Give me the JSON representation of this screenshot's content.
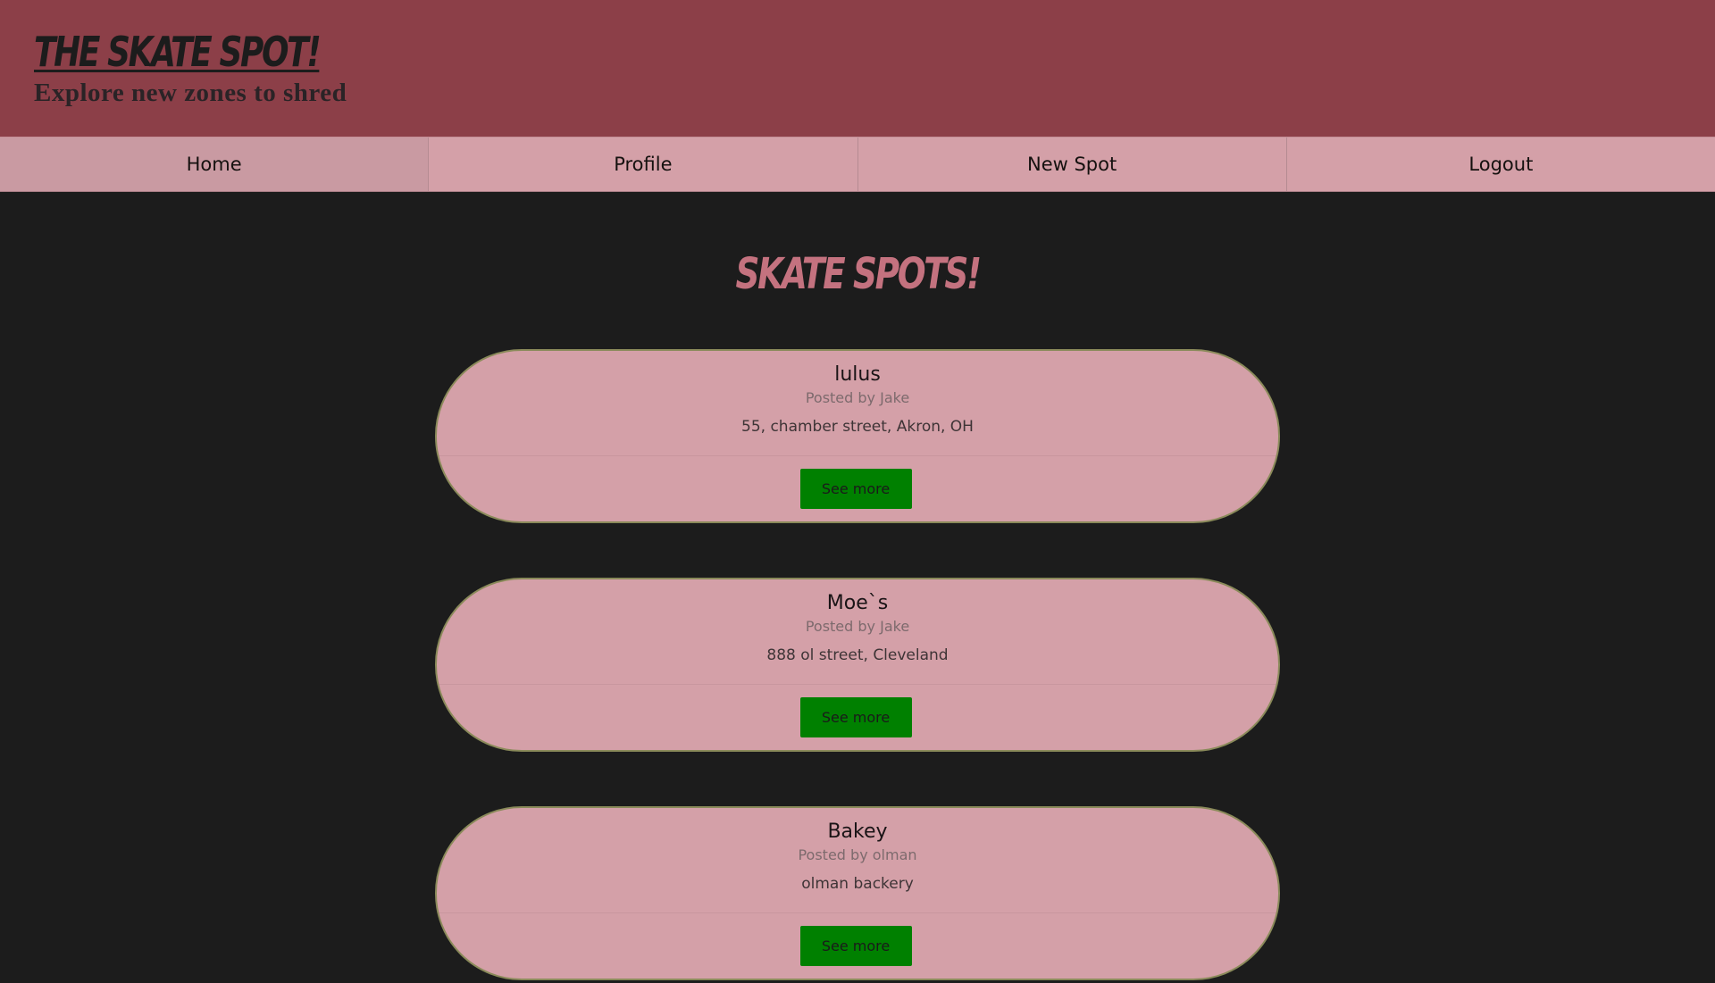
{
  "header": {
    "title": "THE SKATE SPOT!",
    "tagline": "Explore new zones to shred"
  },
  "nav": {
    "items": [
      {
        "label": "Home",
        "active": true
      },
      {
        "label": "Profile"
      },
      {
        "label": "New Spot"
      },
      {
        "label": "Logout"
      }
    ]
  },
  "main": {
    "title": "SKATE SPOTS!",
    "spots": [
      {
        "name": "lulus",
        "author": "Posted by Jake",
        "address": "55, chamber street, Akron, OH",
        "button": "See more"
      },
      {
        "name": "Moe`s",
        "author": "Posted by Jake",
        "address": "888 ol street, Cleveland",
        "button": "See more"
      },
      {
        "name": "Bakey",
        "author": "Posted by olman",
        "address": "olman backery",
        "button": "See more"
      }
    ]
  },
  "colors": {
    "header_bg": "#8c3f48",
    "nav_bg": "#d4a0a8",
    "page_bg": "#1c1c1c",
    "title_accent": "#c4727f",
    "button_green": "#008000"
  }
}
